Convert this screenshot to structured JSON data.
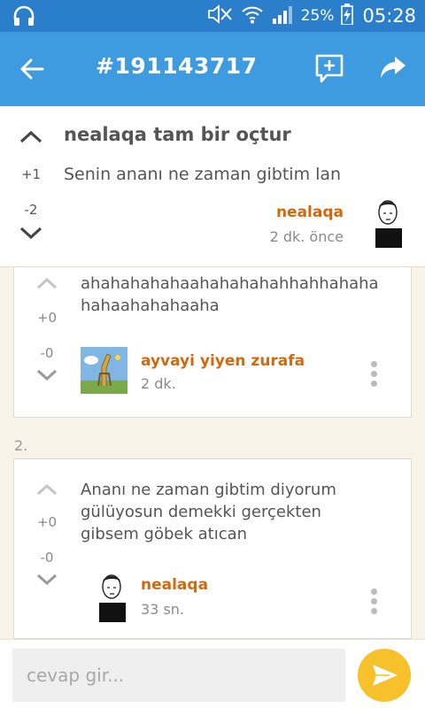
{
  "status_bar": {
    "battery_percent": "25%",
    "time": "05:28"
  },
  "header": {
    "title": "#191143717"
  },
  "post": {
    "upvotes": "+1",
    "downvotes": "-2",
    "title": "nealaqa tam bir oçtur",
    "body": "Senin ananı ne zaman gibtim lan",
    "author": "nealaqa",
    "time": "2 dk. önce"
  },
  "replies": [
    {
      "upvotes": "+0",
      "downvotes": "-0",
      "text_line1": "ahahahahahaahahahahahhahhahaha",
      "text_line2": "hahaahahahaaha",
      "author": "ayvayi yiyen zurafa",
      "time": "2 dk."
    },
    {
      "section_number": "2.",
      "upvotes": "+0",
      "downvotes": "-0",
      "text_line1": "Ananı ne zaman gibtim diyorum",
      "text_line2": "gülüyosun demekki gerçekten",
      "text_line3": "gibsem göbek atıcan",
      "author": "nealaqa",
      "time": "33 sn."
    }
  ],
  "composer": {
    "placeholder": "cevap gir..."
  },
  "colors": {
    "status_bar": "#2b7ec9",
    "app_bar": "#3f9be0",
    "author": "#d4680c",
    "send_button": "#f6c12a",
    "background": "#f7f3e9"
  }
}
